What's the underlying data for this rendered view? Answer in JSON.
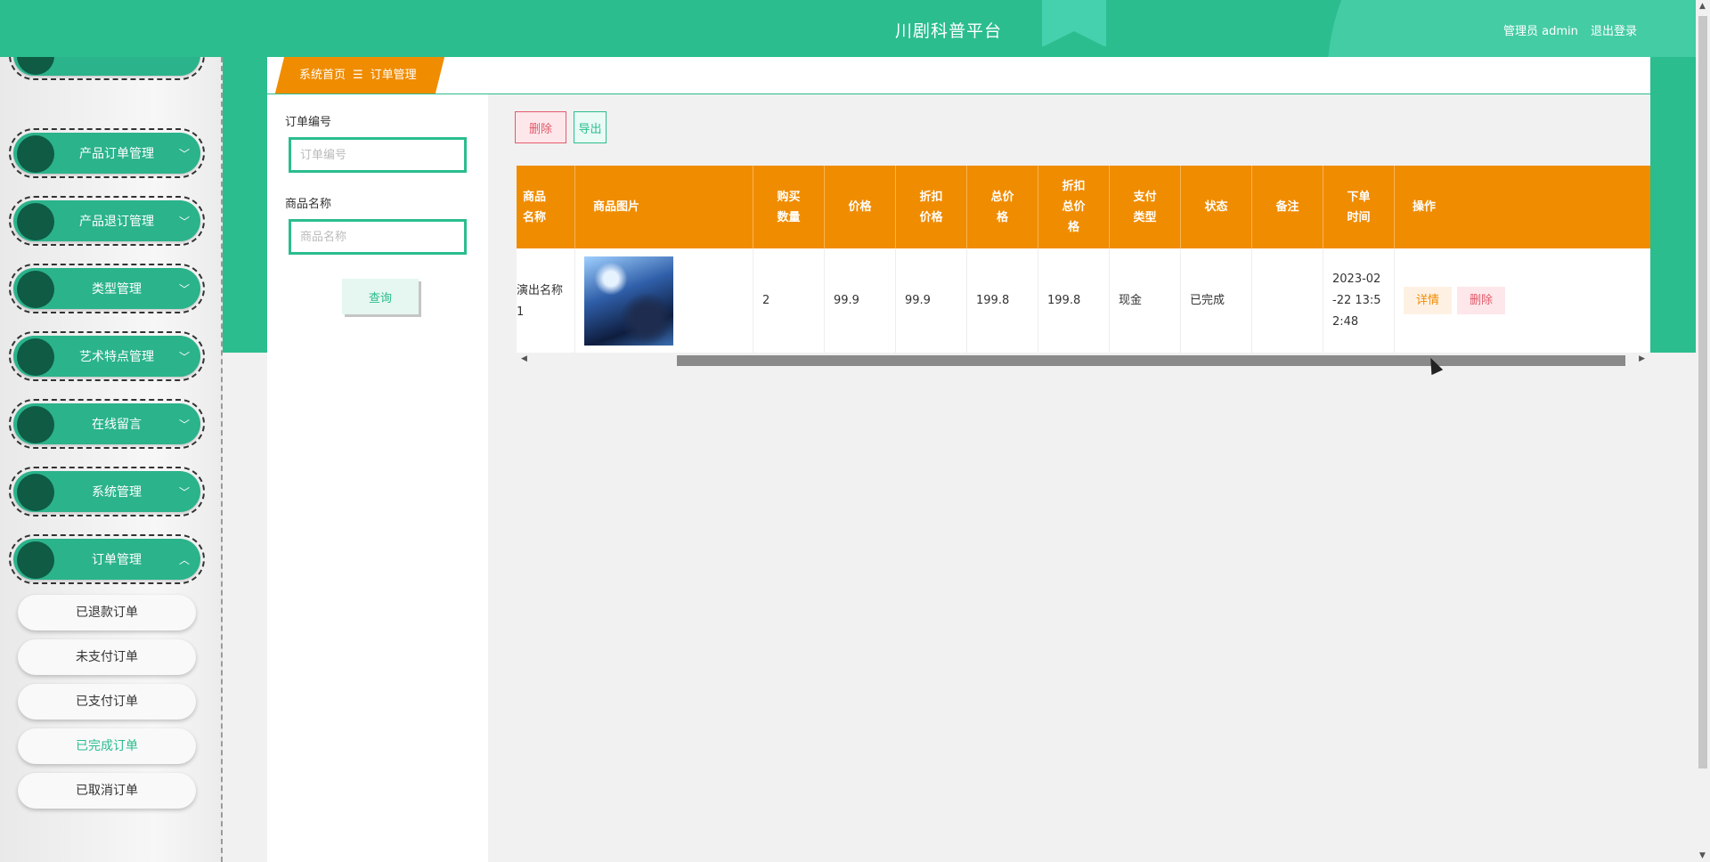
{
  "header": {
    "title": "川剧科普平台",
    "user_label": "管理员 admin",
    "logout_label": "退出登录"
  },
  "sidebar": {
    "items": [
      {
        "label": "产品订单管理",
        "chevron": "﹀"
      },
      {
        "label": "产品退订管理",
        "chevron": "﹀"
      },
      {
        "label": "类型管理",
        "chevron": "﹀"
      },
      {
        "label": "艺术特点管理",
        "chevron": "﹀"
      },
      {
        "label": "在线留言",
        "chevron": "﹀"
      },
      {
        "label": "系统管理",
        "chevron": "﹀"
      },
      {
        "label": "订单管理",
        "chevron": "︿"
      }
    ],
    "subitems": [
      "已退款订单",
      "未支付订单",
      "已支付订单",
      "已完成订单",
      "已取消订单"
    ],
    "active_subitem": "已完成订单"
  },
  "breadcrumb": {
    "home": "系统首页",
    "separator": "☰",
    "current": "订单管理"
  },
  "filter": {
    "order_no_label": "订单编号",
    "order_no_placeholder": "订单编号",
    "product_name_label": "商品名称",
    "product_name_placeholder": "商品名称",
    "query_label": "查询"
  },
  "toolbar": {
    "delete_label": "删除",
    "export_label": "导出"
  },
  "table": {
    "columns": [
      "商品\n名称",
      "商品图片",
      "购买\n数量",
      "价格",
      "折扣\n价格",
      "总价\n格",
      "折扣\n总价\n格",
      "支付\n类型",
      "状态",
      "备注",
      "下单\n时间",
      "操作"
    ],
    "row": {
      "name": "演出名称\n1",
      "quantity": "2",
      "price": "99.9",
      "discount_price": "99.9",
      "total": "199.8",
      "discount_total": "199.8",
      "pay_type": "现金",
      "status": "已完成",
      "remark": "",
      "time": "2023-02\n-22 13:5\n2:48",
      "detail_label": "详情",
      "delete_label": "删除"
    }
  },
  "icons": {
    "scroll_left": "◀",
    "scroll_right": "▶",
    "scroll_up": "▲",
    "scroll_down": "▼"
  },
  "colors": {
    "primary": "#2bbd8e",
    "accent": "#f08c00",
    "danger": "#e45a6b"
  }
}
